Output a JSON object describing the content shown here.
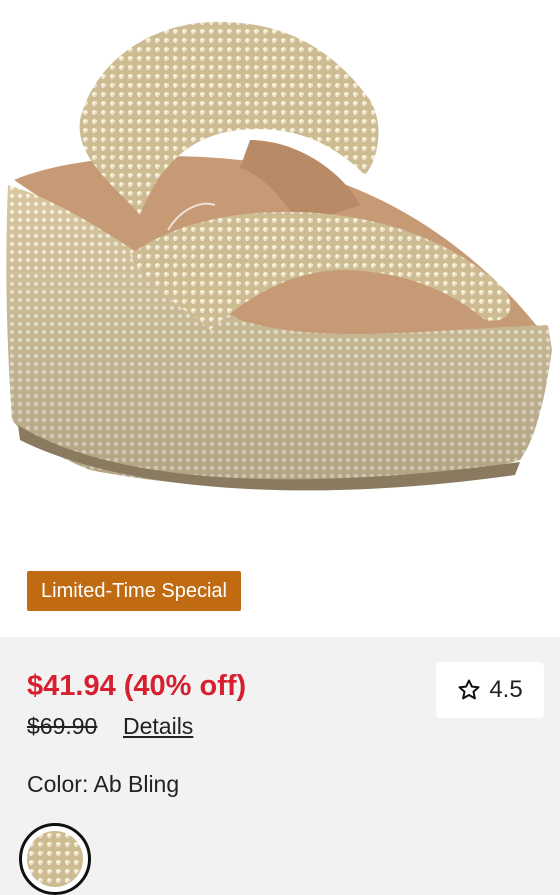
{
  "product": {
    "image_alt": "Rhinestone embellished platform wedge slide sandal",
    "badge": "Limited-Time Special",
    "sale_price": "$41.94 (40% off)",
    "original_price": "$69.90",
    "details_link": "Details",
    "rating": "4.5",
    "color_label": "Color: Ab Bling",
    "swatch_name": "Ab Bling"
  },
  "colors": {
    "sale_red": "#d6202f",
    "badge_orange": "#c06a12",
    "panel_gray": "#f2f2f2"
  },
  "icons": {
    "rating": "star-outline-icon"
  }
}
